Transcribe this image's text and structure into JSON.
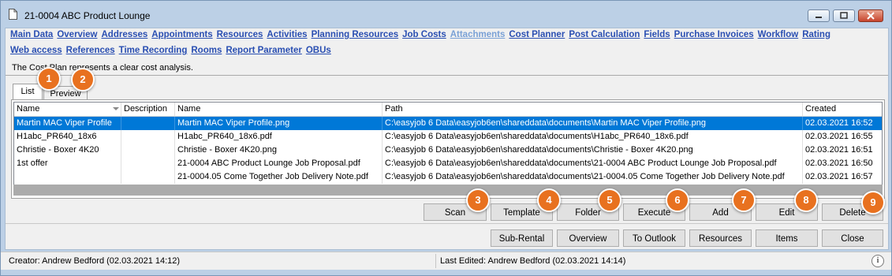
{
  "window": {
    "title": "21-0004 ABC Product Lounge"
  },
  "nav": {
    "row1": [
      {
        "label": "Main Data",
        "disabled": false
      },
      {
        "label": "Overview",
        "disabled": false
      },
      {
        "label": "Addresses",
        "disabled": false
      },
      {
        "label": "Appointments",
        "disabled": false
      },
      {
        "label": "Resources",
        "disabled": false
      },
      {
        "label": "Activities",
        "disabled": false
      },
      {
        "label": "Planning Resources",
        "disabled": false
      },
      {
        "label": "Job Costs",
        "disabled": false
      },
      {
        "label": "Attachments",
        "disabled": true
      },
      {
        "label": "Cost Planner",
        "disabled": false
      },
      {
        "label": "Post Calculation",
        "disabled": false
      },
      {
        "label": "Fields",
        "disabled": false
      },
      {
        "label": "Purchase Invoices",
        "disabled": false
      },
      {
        "label": "Workflow",
        "disabled": false
      },
      {
        "label": "Rating",
        "disabled": false
      }
    ],
    "row2": [
      {
        "label": "Web access",
        "disabled": false
      },
      {
        "label": "References",
        "disabled": false
      },
      {
        "label": "Time Recording",
        "disabled": false
      },
      {
        "label": "Rooms",
        "disabled": false
      },
      {
        "label": "Report Parameter",
        "disabled": false
      },
      {
        "label": "OBUs",
        "disabled": false
      }
    ]
  },
  "description": "The Cost Plan represents a clear cost analysis.",
  "tabs": {
    "list": "List",
    "preview": "Preview"
  },
  "table": {
    "headers": [
      "Name",
      "Description",
      "Name",
      "Path",
      "Created"
    ],
    "rows": [
      [
        "Martin MAC Viper Profile",
        "",
        "Martin MAC Viper Profile.png",
        "C:\\easyjob 6 Data\\easyjob6en\\shareddata\\documents\\Martin MAC Viper Profile.png",
        "02.03.2021 16:52"
      ],
      [
        "H1abc_PR640_18x6",
        "",
        "H1abc_PR640_18x6.pdf",
        "C:\\easyjob 6 Data\\easyjob6en\\shareddata\\documents\\H1abc_PR640_18x6.pdf",
        "02.03.2021 16:55"
      ],
      [
        "Christie - Boxer 4K20",
        "",
        "Christie - Boxer 4K20.png",
        "C:\\easyjob 6 Data\\easyjob6en\\shareddata\\documents\\Christie - Boxer 4K20.png",
        "02.03.2021 16:51"
      ],
      [
        "1st offer",
        "",
        "21-0004 ABC Product Lounge Job Proposal.pdf",
        "C:\\easyjob 6 Data\\easyjob6en\\shareddata\\documents\\21-0004 ABC Product Lounge Job Proposal.pdf",
        "02.03.2021 16:50"
      ],
      [
        "",
        "",
        "21-0004.05 Come Together Job Delivery Note.pdf",
        "C:\\easyjob 6 Data\\easyjob6en\\shareddata\\documents\\21-0004.05 Come Together Job Delivery Note.pdf",
        "02.03.2021 16:57"
      ]
    ],
    "selected_row": 0
  },
  "actions": {
    "scan": "Scan",
    "template": "Template",
    "folder": "Folder",
    "execute": "Execute",
    "add": "Add",
    "edit": "Edit",
    "delete": "Delete"
  },
  "footer_buttons": {
    "subrental": "Sub-Rental",
    "overview": "Overview",
    "to_outlook": "To Outlook",
    "resources": "Resources",
    "items": "Items",
    "close": "Close"
  },
  "badges": [
    "1",
    "2",
    "3",
    "4",
    "5",
    "6",
    "7",
    "8",
    "9"
  ],
  "status": {
    "creator": "Creator: Andrew Bedford (02.03.2021 14:12)",
    "last_edited": "Last Edited:  Andrew Bedford (02.03.2021 14:14)",
    "info": "i"
  },
  "colors": {
    "accent": "#0078d7",
    "badge": "#e8711f",
    "link": "#2a4fb2",
    "link_disabled": "#7aa1d6"
  }
}
